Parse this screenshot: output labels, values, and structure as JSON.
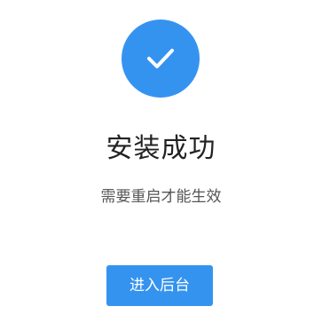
{
  "status": {
    "icon": "checkmark-icon",
    "title": "安装成功",
    "message": "需要重启才能生效"
  },
  "actions": {
    "enter_admin_label": "进入后台"
  },
  "colors": {
    "accent": "#3593f0",
    "title_text": "#222222",
    "message_text": "#555555",
    "background": "#ffffff"
  }
}
